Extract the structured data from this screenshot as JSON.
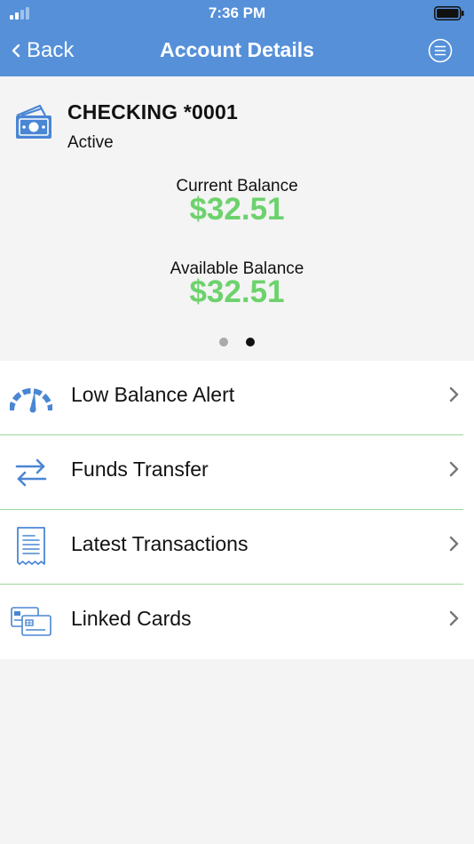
{
  "status_bar": {
    "time": "7:36 PM"
  },
  "nav": {
    "back_label": "Back",
    "title": "Account Details"
  },
  "account": {
    "name": "CHECKING *0001",
    "status": "Active",
    "current_balance_label": "Current Balance",
    "current_balance": "$32.51",
    "available_balance_label": "Available Balance",
    "available_balance": "$32.51",
    "page_count": 2,
    "active_page": 2
  },
  "menu": {
    "items": [
      {
        "label": "Low Balance Alert",
        "icon": "gauge-icon"
      },
      {
        "label": "Funds Transfer",
        "icon": "transfer-arrows-icon"
      },
      {
        "label": "Latest Transactions",
        "icon": "receipt-icon"
      },
      {
        "label": "Linked Cards",
        "icon": "cards-icon"
      }
    ]
  },
  "colors": {
    "header": "#5590d9",
    "balance": "#6dd26d",
    "icon": "#4a86d4",
    "divider": "#9ed69a",
    "background": "#f4f4f4"
  }
}
